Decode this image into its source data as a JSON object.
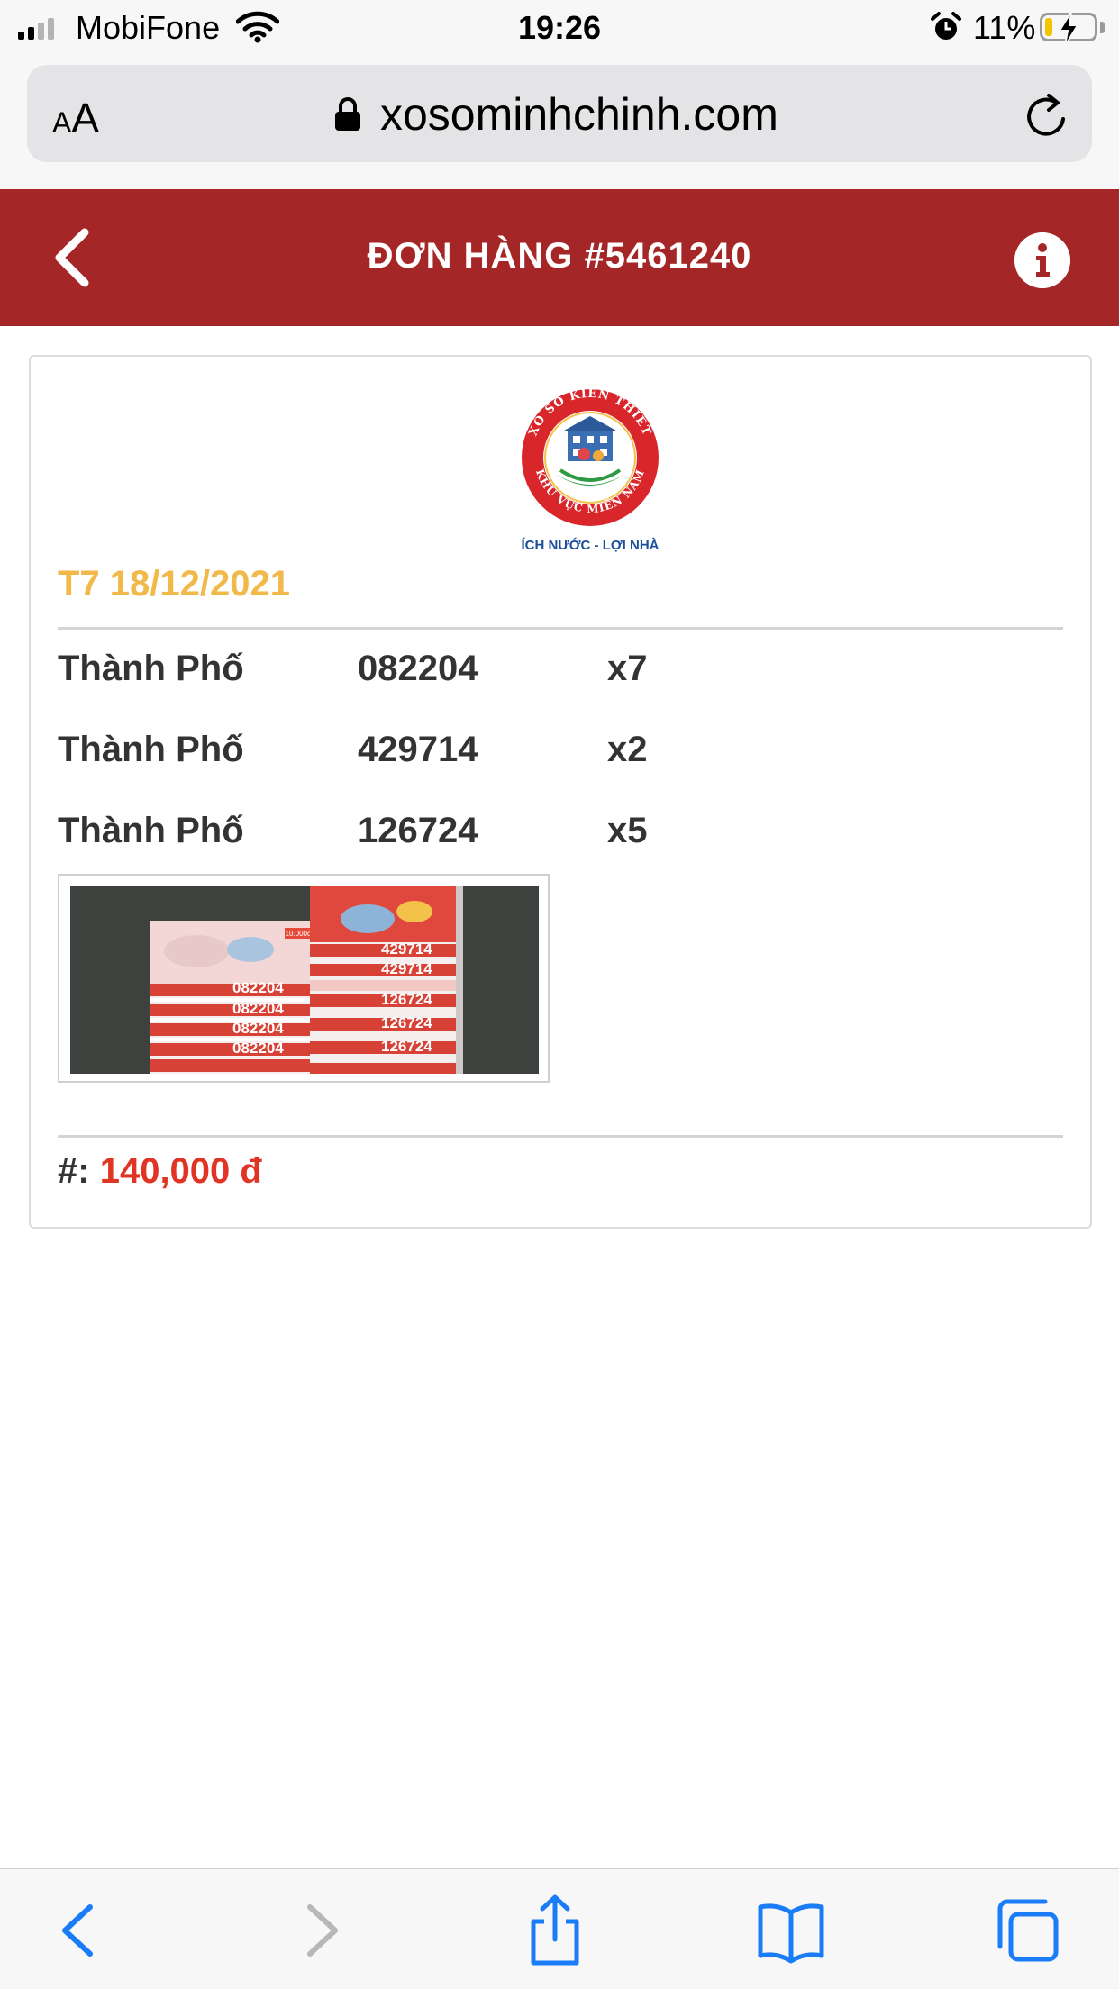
{
  "status_bar": {
    "carrier": "MobiFone",
    "time": "19:26",
    "battery_percent": "11%",
    "battery_level": 0.11,
    "icons": [
      "signal-icon",
      "wifi-icon",
      "alarm-icon",
      "battery-charging-icon"
    ]
  },
  "browser": {
    "text_size_small": "A",
    "text_size_large": "A",
    "url": "xosominhchinh.com",
    "icons": [
      "lock-icon",
      "reload-icon"
    ],
    "toolbar_icons": [
      "back-icon",
      "forward-icon",
      "share-icon",
      "bookmarks-icon",
      "tabs-icon"
    ]
  },
  "header": {
    "title": "ĐƠN HÀNG #5461240",
    "background_color": "#a52626",
    "icons": [
      "chevron-left-icon",
      "info-icon"
    ]
  },
  "order": {
    "logo": {
      "seal_text": "XỔ SỐ KIẾN THIẾT · KHU VỰC MIỀN NAM",
      "slogan": "ÍCH NƯỚC - LỢI NHÀ"
    },
    "draw_date": "T7 18/12/2021",
    "tickets": [
      {
        "province": "Thành Phố",
        "number": "082204",
        "quantity": "x7"
      },
      {
        "province": "Thành Phố",
        "number": "429714",
        "quantity": "x2"
      },
      {
        "province": "Thành Phố",
        "number": "126724",
        "quantity": "x5"
      }
    ],
    "photo": {
      "ticket_price": "10.000đ",
      "numbers_shown": [
        "082204",
        "429714",
        "126724"
      ]
    },
    "total_label": "#:",
    "total_amount": "140,000 đ",
    "colors": {
      "date": "#f1b94a",
      "total": "#e03525"
    }
  }
}
